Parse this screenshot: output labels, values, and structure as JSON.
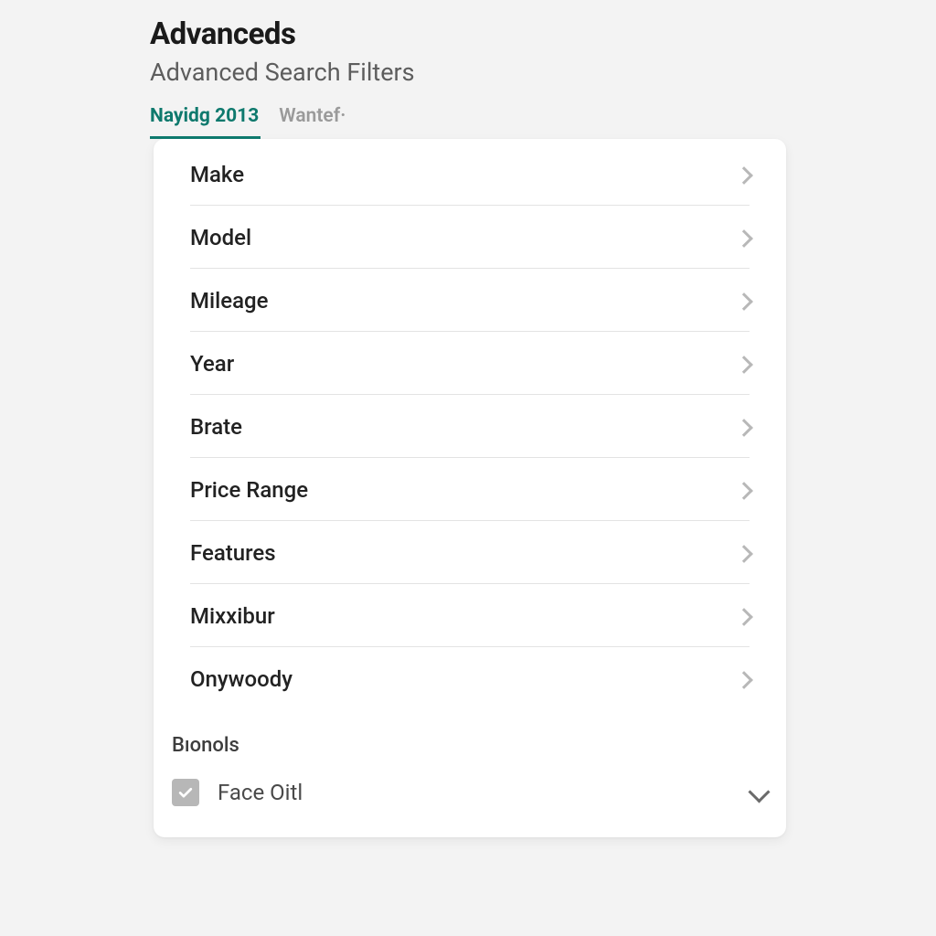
{
  "header": {
    "title": "Advanceds",
    "subtitle": "Advanced Search Filters"
  },
  "tabs": [
    {
      "label": "Nayidg 2013",
      "active": true
    },
    {
      "label": "Wantef·",
      "active": false
    }
  ],
  "filters": [
    {
      "label": "Make"
    },
    {
      "label": "Model"
    },
    {
      "label": "Mileage"
    },
    {
      "label": "Year"
    },
    {
      "label": "Brate"
    },
    {
      "label": "Price Range"
    },
    {
      "label": "Features"
    },
    {
      "label": "Mixxibur"
    },
    {
      "label": "Onywoody"
    }
  ],
  "section": {
    "label": "Bıonols",
    "option": {
      "label": "Face Oitl",
      "checked": true
    }
  }
}
